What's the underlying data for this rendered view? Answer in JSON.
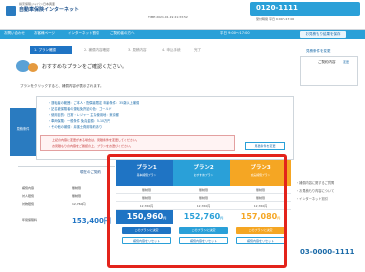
{
  "header": {
    "site_name": "自動車保険インターネット",
    "small_note": "損害保険ジャパン日本興亜",
    "info": "TIME:2021.01.19 21:33:52",
    "phone": "0120-1111",
    "phone_note": "受付時間 平日 9:00～17:00"
  },
  "nav": {
    "items": [
      "お問い合わせ",
      "お客様ページ",
      "インターネット割引",
      "ご契約者の方へ",
      "平日 9:00～17:00"
    ],
    "button": "お見積もり結果を保存"
  },
  "steps": [
    {
      "label": "1. プラン確認",
      "active": true
    },
    {
      "label": "2. 補償内容確認",
      "active": false
    },
    {
      "label": "3. 見積内容",
      "active": false
    },
    {
      "label": "4. 申込手続",
      "active": false
    },
    {
      "label": "完了",
      "active": false
    }
  ],
  "main": {
    "heading": "おすすめなプランをご確認ください。",
    "check_line": "プランをクリックすると、補償内容が表示されます。",
    "side_label": "見積条件",
    "info_lines": [
      "・運転者の範囲：ご本人・配偶者限定   年齢条件：35歳以上補償",
      "・記名被保険者の運転免許証の色：ゴールド",
      "・使用目的：日常・レジャー   主な使用地：東京都",
      "・車両保険：一般条件   免責金額：5-10万円",
      "・その他の補償：弁護士費用特約あり"
    ],
    "alert_lines": [
      "上記の内容に変更がある場合は、見積条件を変更してください。",
      "お見積もりの内容をご確認の上、プランをお選びください。"
    ],
    "change_button": "見積条件を変更"
  },
  "table": {
    "left_header": "現在のご契約",
    "row_labels": [
      "補償内容",
      "対人賠償",
      "対物賠償",
      "年間保険料"
    ],
    "row_values": [
      "無制限",
      "無制限",
      "12,760円",
      "153,400円"
    ]
  },
  "plans": [
    {
      "name": "プラン1",
      "sub": "基本補償プラン",
      "color": "#1f74c4",
      "cells": [
        "無制限",
        "無制限",
        "12,760円"
      ],
      "price": "150,960",
      "unit": "円",
      "select_label": "このプランに決定",
      "detail_label": "補償内容をリセット"
    },
    {
      "name": "プラン2",
      "sub": "おすすめプラン",
      "color": "#2aa0d8",
      "cells": [
        "無制限",
        "無制限",
        "12,760円"
      ],
      "price": "152,760",
      "unit": "円",
      "select_label": "このプランに決定",
      "detail_label": "補償内容をリセット"
    },
    {
      "name": "プラン3",
      "sub": "充実補償プラン",
      "color": "#f5a623",
      "cells": [
        "無制限",
        "無制限",
        "12,760円"
      ],
      "price": "157,080",
      "unit": "円",
      "select_label": "このプランに決定",
      "detail_label": "補償内容をリセット"
    }
  ],
  "right_panel": {
    "title": "見積条件を変更",
    "label": "ご契約内容",
    "value": "変更",
    "notes": [
      "・補償内容に関するご質問",
      "・お見積もり内容について",
      "・インターネット割引"
    ],
    "hotline": "03-0000-1111"
  },
  "colors": {
    "accent": "#2aa0d8",
    "primary": "#1f74c4",
    "orange": "#f5a623",
    "highlight": "#e3231b"
  }
}
